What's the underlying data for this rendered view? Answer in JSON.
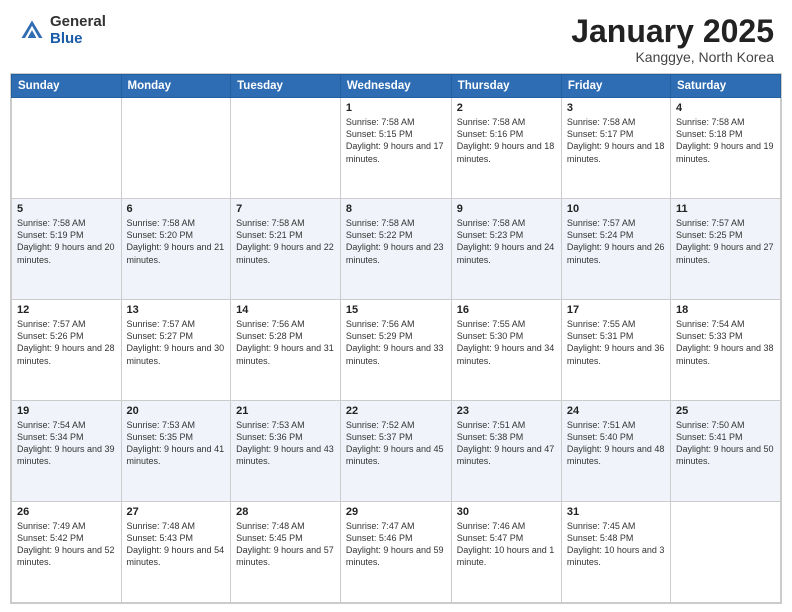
{
  "header": {
    "logo_general": "General",
    "logo_blue": "Blue",
    "month_title": "January 2025",
    "location": "Kanggye, North Korea"
  },
  "days_of_week": [
    "Sunday",
    "Monday",
    "Tuesday",
    "Wednesday",
    "Thursday",
    "Friday",
    "Saturday"
  ],
  "weeks": [
    [
      {
        "day": "",
        "sunrise": "",
        "sunset": "",
        "daylight": ""
      },
      {
        "day": "",
        "sunrise": "",
        "sunset": "",
        "daylight": ""
      },
      {
        "day": "",
        "sunrise": "",
        "sunset": "",
        "daylight": ""
      },
      {
        "day": "1",
        "sunrise": "Sunrise: 7:58 AM",
        "sunset": "Sunset: 5:15 PM",
        "daylight": "Daylight: 9 hours and 17 minutes."
      },
      {
        "day": "2",
        "sunrise": "Sunrise: 7:58 AM",
        "sunset": "Sunset: 5:16 PM",
        "daylight": "Daylight: 9 hours and 18 minutes."
      },
      {
        "day": "3",
        "sunrise": "Sunrise: 7:58 AM",
        "sunset": "Sunset: 5:17 PM",
        "daylight": "Daylight: 9 hours and 18 minutes."
      },
      {
        "day": "4",
        "sunrise": "Sunrise: 7:58 AM",
        "sunset": "Sunset: 5:18 PM",
        "daylight": "Daylight: 9 hours and 19 minutes."
      }
    ],
    [
      {
        "day": "5",
        "sunrise": "Sunrise: 7:58 AM",
        "sunset": "Sunset: 5:19 PM",
        "daylight": "Daylight: 9 hours and 20 minutes."
      },
      {
        "day": "6",
        "sunrise": "Sunrise: 7:58 AM",
        "sunset": "Sunset: 5:20 PM",
        "daylight": "Daylight: 9 hours and 21 minutes."
      },
      {
        "day": "7",
        "sunrise": "Sunrise: 7:58 AM",
        "sunset": "Sunset: 5:21 PM",
        "daylight": "Daylight: 9 hours and 22 minutes."
      },
      {
        "day": "8",
        "sunrise": "Sunrise: 7:58 AM",
        "sunset": "Sunset: 5:22 PM",
        "daylight": "Daylight: 9 hours and 23 minutes."
      },
      {
        "day": "9",
        "sunrise": "Sunrise: 7:58 AM",
        "sunset": "Sunset: 5:23 PM",
        "daylight": "Daylight: 9 hours and 24 minutes."
      },
      {
        "day": "10",
        "sunrise": "Sunrise: 7:57 AM",
        "sunset": "Sunset: 5:24 PM",
        "daylight": "Daylight: 9 hours and 26 minutes."
      },
      {
        "day": "11",
        "sunrise": "Sunrise: 7:57 AM",
        "sunset": "Sunset: 5:25 PM",
        "daylight": "Daylight: 9 hours and 27 minutes."
      }
    ],
    [
      {
        "day": "12",
        "sunrise": "Sunrise: 7:57 AM",
        "sunset": "Sunset: 5:26 PM",
        "daylight": "Daylight: 9 hours and 28 minutes."
      },
      {
        "day": "13",
        "sunrise": "Sunrise: 7:57 AM",
        "sunset": "Sunset: 5:27 PM",
        "daylight": "Daylight: 9 hours and 30 minutes."
      },
      {
        "day": "14",
        "sunrise": "Sunrise: 7:56 AM",
        "sunset": "Sunset: 5:28 PM",
        "daylight": "Daylight: 9 hours and 31 minutes."
      },
      {
        "day": "15",
        "sunrise": "Sunrise: 7:56 AM",
        "sunset": "Sunset: 5:29 PM",
        "daylight": "Daylight: 9 hours and 33 minutes."
      },
      {
        "day": "16",
        "sunrise": "Sunrise: 7:55 AM",
        "sunset": "Sunset: 5:30 PM",
        "daylight": "Daylight: 9 hours and 34 minutes."
      },
      {
        "day": "17",
        "sunrise": "Sunrise: 7:55 AM",
        "sunset": "Sunset: 5:31 PM",
        "daylight": "Daylight: 9 hours and 36 minutes."
      },
      {
        "day": "18",
        "sunrise": "Sunrise: 7:54 AM",
        "sunset": "Sunset: 5:33 PM",
        "daylight": "Daylight: 9 hours and 38 minutes."
      }
    ],
    [
      {
        "day": "19",
        "sunrise": "Sunrise: 7:54 AM",
        "sunset": "Sunset: 5:34 PM",
        "daylight": "Daylight: 9 hours and 39 minutes."
      },
      {
        "day": "20",
        "sunrise": "Sunrise: 7:53 AM",
        "sunset": "Sunset: 5:35 PM",
        "daylight": "Daylight: 9 hours and 41 minutes."
      },
      {
        "day": "21",
        "sunrise": "Sunrise: 7:53 AM",
        "sunset": "Sunset: 5:36 PM",
        "daylight": "Daylight: 9 hours and 43 minutes."
      },
      {
        "day": "22",
        "sunrise": "Sunrise: 7:52 AM",
        "sunset": "Sunset: 5:37 PM",
        "daylight": "Daylight: 9 hours and 45 minutes."
      },
      {
        "day": "23",
        "sunrise": "Sunrise: 7:51 AM",
        "sunset": "Sunset: 5:38 PM",
        "daylight": "Daylight: 9 hours and 47 minutes."
      },
      {
        "day": "24",
        "sunrise": "Sunrise: 7:51 AM",
        "sunset": "Sunset: 5:40 PM",
        "daylight": "Daylight: 9 hours and 48 minutes."
      },
      {
        "day": "25",
        "sunrise": "Sunrise: 7:50 AM",
        "sunset": "Sunset: 5:41 PM",
        "daylight": "Daylight: 9 hours and 50 minutes."
      }
    ],
    [
      {
        "day": "26",
        "sunrise": "Sunrise: 7:49 AM",
        "sunset": "Sunset: 5:42 PM",
        "daylight": "Daylight: 9 hours and 52 minutes."
      },
      {
        "day": "27",
        "sunrise": "Sunrise: 7:48 AM",
        "sunset": "Sunset: 5:43 PM",
        "daylight": "Daylight: 9 hours and 54 minutes."
      },
      {
        "day": "28",
        "sunrise": "Sunrise: 7:48 AM",
        "sunset": "Sunset: 5:45 PM",
        "daylight": "Daylight: 9 hours and 57 minutes."
      },
      {
        "day": "29",
        "sunrise": "Sunrise: 7:47 AM",
        "sunset": "Sunset: 5:46 PM",
        "daylight": "Daylight: 9 hours and 59 minutes."
      },
      {
        "day": "30",
        "sunrise": "Sunrise: 7:46 AM",
        "sunset": "Sunset: 5:47 PM",
        "daylight": "Daylight: 10 hours and 1 minute."
      },
      {
        "day": "31",
        "sunrise": "Sunrise: 7:45 AM",
        "sunset": "Sunset: 5:48 PM",
        "daylight": "Daylight: 10 hours and 3 minutes."
      },
      {
        "day": "",
        "sunrise": "",
        "sunset": "",
        "daylight": ""
      }
    ]
  ]
}
